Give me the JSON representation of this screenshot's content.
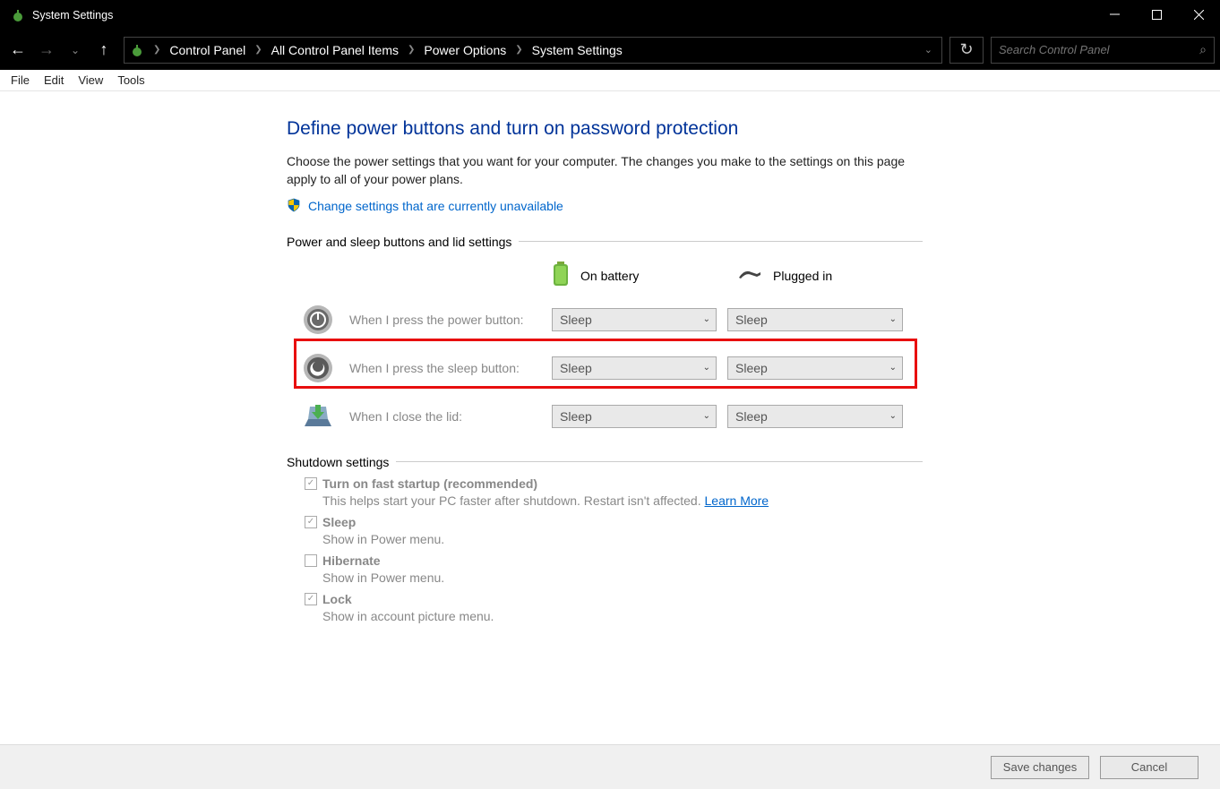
{
  "window": {
    "title": "System Settings"
  },
  "nav": {
    "crumbs": [
      "Control Panel",
      "All Control Panel Items",
      "Power Options",
      "System Settings"
    ],
    "search_placeholder": "Search Control Panel"
  },
  "menu": {
    "items": [
      "File",
      "Edit",
      "View",
      "Tools"
    ]
  },
  "page": {
    "title": "Define power buttons and turn on password protection",
    "subtitle": "Choose the power settings that you want for your computer. The changes you make to the settings on this page apply to all of your power plans.",
    "admin_link": "Change settings that are currently unavailable",
    "section1": "Power and sleep buttons and lid settings",
    "cols": {
      "battery": "On battery",
      "plugged": "Plugged in"
    },
    "rows": [
      {
        "label": "When I press the power button:",
        "battery": "Sleep",
        "plugged": "Sleep"
      },
      {
        "label": "When I press the sleep button:",
        "battery": "Sleep",
        "plugged": "Sleep"
      },
      {
        "label": "When I close the lid:",
        "battery": "Sleep",
        "plugged": "Sleep"
      }
    ],
    "section2": "Shutdown settings",
    "shutdown": [
      {
        "label": "Turn on fast startup (recommended)",
        "checked": true,
        "desc": "This helps start your PC faster after shutdown. Restart isn't affected. ",
        "link": "Learn More"
      },
      {
        "label": "Sleep",
        "checked": true,
        "desc": "Show in Power menu."
      },
      {
        "label": "Hibernate",
        "checked": false,
        "desc": "Show in Power menu."
      },
      {
        "label": "Lock",
        "checked": true,
        "desc": "Show in account picture menu."
      }
    ],
    "footer": {
      "save": "Save changes",
      "cancel": "Cancel"
    }
  }
}
